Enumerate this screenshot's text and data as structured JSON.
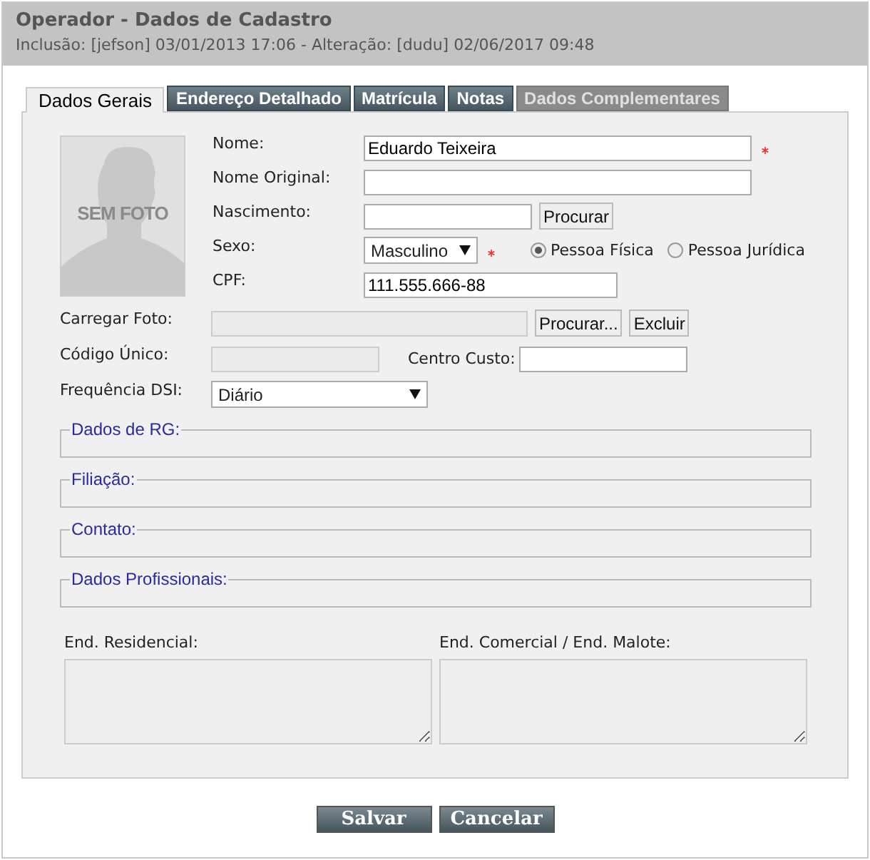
{
  "window": {
    "title": "Operador - Dados de Cadastro",
    "subtitle": "Inclusão: [jefson] 03/01/2013 17:06 - Alteração: [dudu] 02/06/2017 09:48"
  },
  "tabs": [
    {
      "label": "Dados Gerais",
      "selected": true,
      "disabled": false
    },
    {
      "label": "Endereço Detalhado",
      "selected": false,
      "disabled": false
    },
    {
      "label": "Matrícula",
      "selected": false,
      "disabled": false
    },
    {
      "label": "Notas",
      "selected": false,
      "disabled": false
    },
    {
      "label": "Dados Complementares",
      "selected": false,
      "disabled": true
    }
  ],
  "photo": {
    "caption": "SEM FOTO"
  },
  "nome": {
    "label": "Nome:",
    "value": "Eduardo Teixeira",
    "required": true
  },
  "nome_original": {
    "label": "Nome Original:"
  },
  "nascimento": {
    "label": "Nascimento:",
    "button": "Procurar"
  },
  "sexo": {
    "label": "Sexo:",
    "value": "Masculino",
    "required": true
  },
  "person_type": [
    {
      "label": "Pessoa Física",
      "selected": true
    },
    {
      "label": "Pessoa Jurídica",
      "selected": false
    }
  ],
  "cpf": {
    "label": "CPF:",
    "value": "111.555.666-88"
  },
  "carregar_foto": {
    "label": "Carregar Foto:",
    "disabled": true,
    "buttons": [
      "Procurar...",
      "Excluir"
    ]
  },
  "codigo_unico": {
    "label": "Código Único:",
    "disabled": true
  },
  "centro_custo": {
    "label": "Centro Custo:"
  },
  "frequencia": {
    "label": "Frequência DSI:",
    "value": "Diário"
  },
  "sections": [
    "Dados de RG:",
    "Filiação:",
    "Contato:",
    "Dados Profissionais:"
  ],
  "addresses": [
    {
      "label": "End. Residencial:"
    },
    {
      "label": "End. Comercial / End. Malote:"
    }
  ],
  "buttons": [
    "Salvar",
    "Cancelar"
  ]
}
